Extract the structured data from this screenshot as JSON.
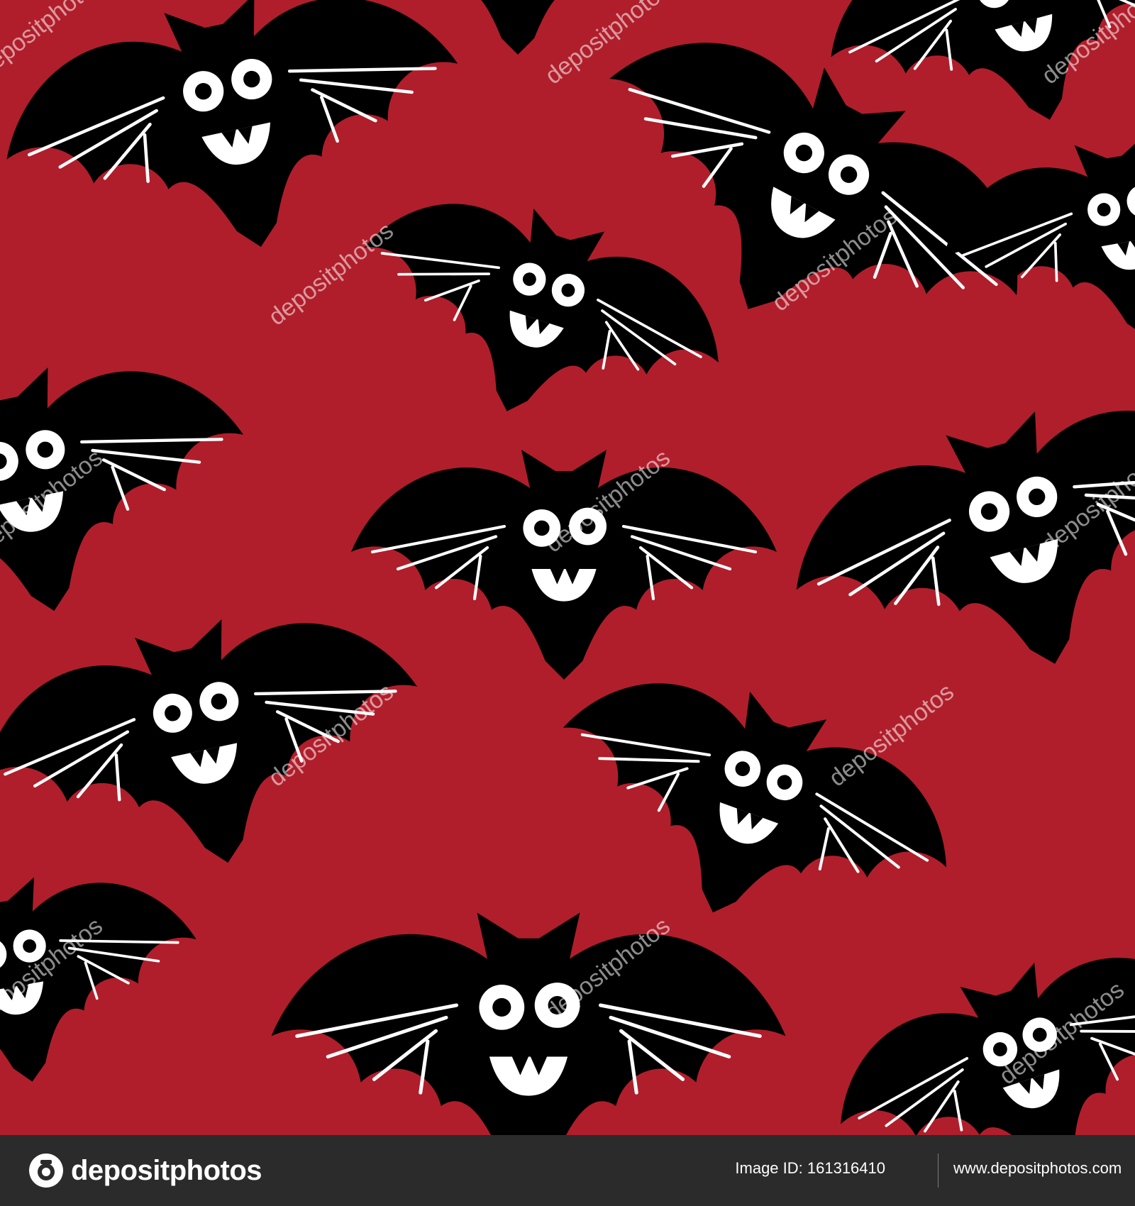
{
  "colors": {
    "background": "#b01e2b",
    "bat": "#000000",
    "bat_features": "#ffffff",
    "footer": "#2b2b2b"
  },
  "pattern": {
    "motif": "bat-icon",
    "description_visible": "repeating cartoon bats"
  },
  "watermark": {
    "text": "depositphotos"
  },
  "footer": {
    "logo_text": "depositphotos",
    "image_id": "Image ID: 161316410",
    "url": "www.depositphotos.com"
  }
}
